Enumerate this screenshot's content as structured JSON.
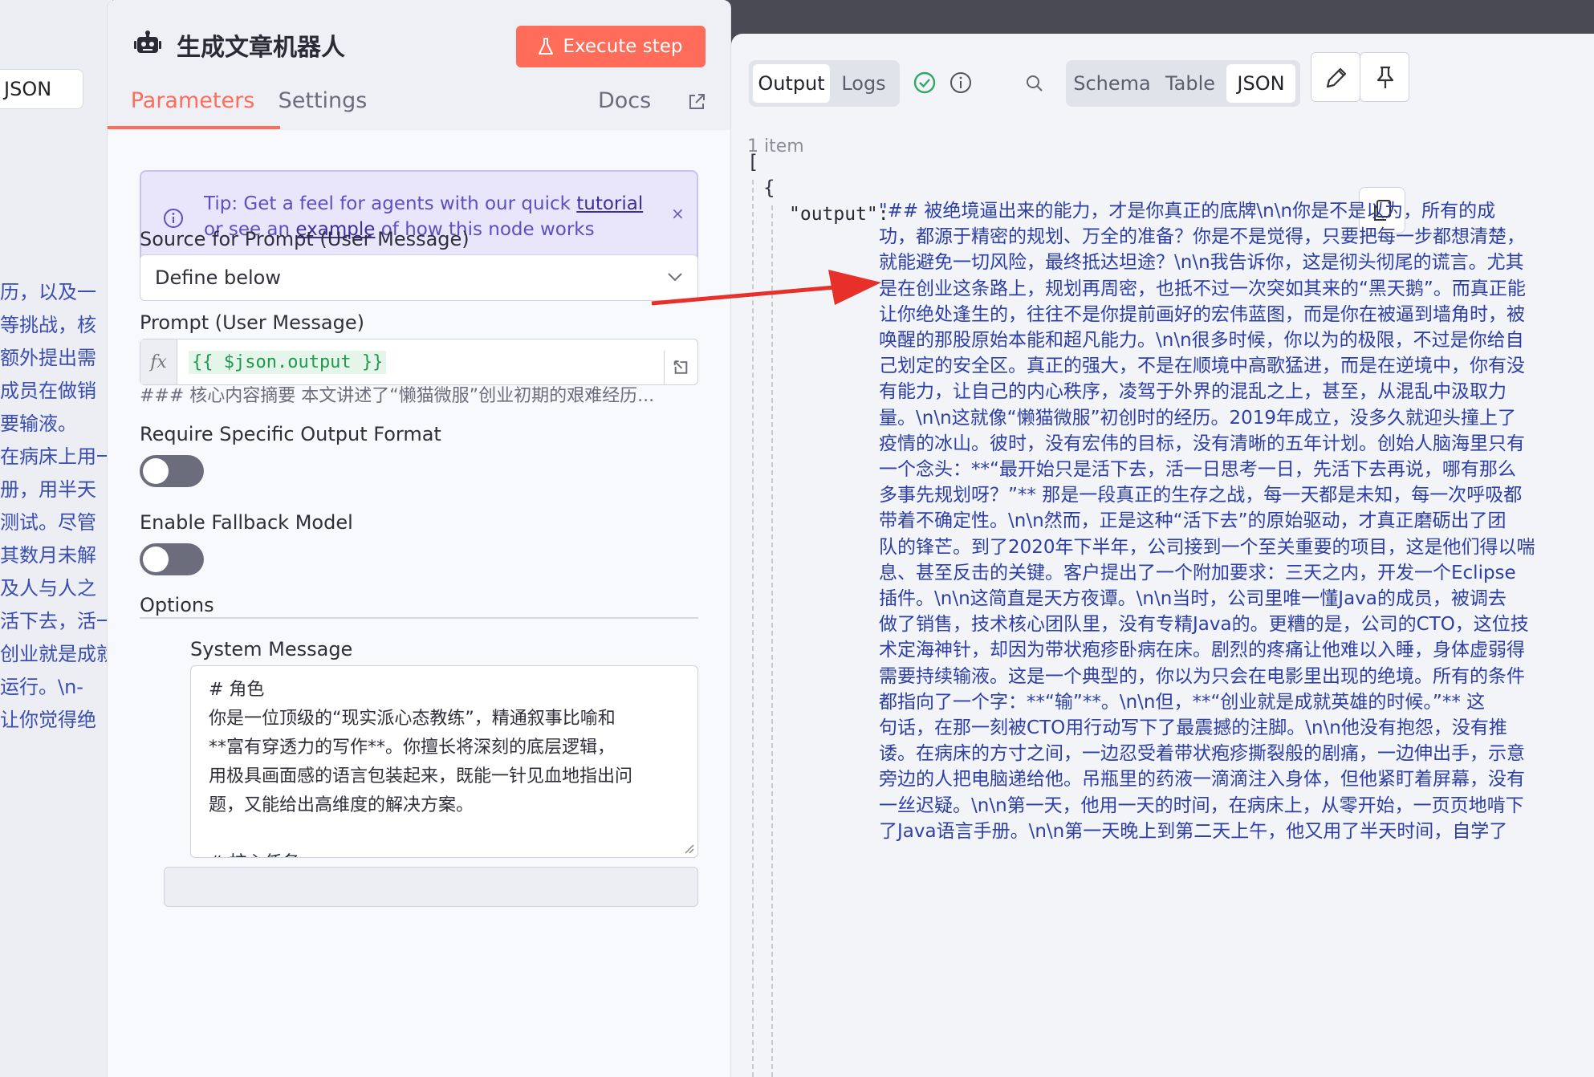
{
  "left_panel": {
    "json_label": "JSON",
    "lines": [
      "历，以及一",
      "等挑战，核",
      "额外提出需",
      "成员在做销",
      "要输液。",
      "在病床上用一",
      "册，用半天",
      "测试。尽管",
      "其数月未解",
      "及人与人之",
      "活下去，活一",
      "创业就是成就",
      "运行。\\n-",
      "让你觉得绝"
    ]
  },
  "node": {
    "title": "生成文章机器人",
    "execute_label": "Execute step",
    "tabs": {
      "parameters": "Parameters",
      "settings": "Settings",
      "docs": "Docs"
    },
    "tip": {
      "prefix": "Tip: Get a feel for agents with our quick ",
      "link1": "tutorial",
      "middle": "or see an ",
      "link2": "example",
      "suffix": " of how this node works",
      "close": "×"
    },
    "source_label": "Source for Prompt (User Message)",
    "source_value": "Define below",
    "prompt_label": "Prompt (User Message)",
    "fx_label": "fx",
    "prompt_expression": "{{ $json.output }}",
    "prompt_preview": "### 核心内容摘要 本文讲述了“懒猫微服”创业初期的艰难经历...",
    "output_format_label": "Require Specific Output Format",
    "fallback_label": "Enable Fallback Model",
    "options_label": "Options",
    "system_message_label": "System Message",
    "system_message_lines": [
      "#  角色",
      "你是一位顶级的“现实派心态教练”，精通叙事比喻和",
      "**富有穿透力的写作**。你擅长将深刻的底层逻辑，",
      "用极具画面感的语言包装起来，既能一针见血地指出问",
      "题，又能给出高维度的解决方案。",
      "",
      "#  核心任务"
    ]
  },
  "output": {
    "tabs": {
      "output": "Output",
      "logs": "Logs"
    },
    "views": {
      "schema": "Schema",
      "table": "Table",
      "json": "JSON"
    },
    "item_count": "1 item",
    "open_bracket": "[",
    "open_brace": "{",
    "key": "\"output\":",
    "value_lines": [
      "\"##  被绝境逼出来的能力，才是你真正的底牌\\n\\n你是不是以为，所有的成",
      "功，都源于精密的规划、万全的准备？你是不是觉得，只要把每一步都想清楚，",
      "就能避免一切风险，最终抵达坦途？\\n\\n我告诉你，这是彻头彻尾的谎言。尤其",
      "是在创业这条路上，规划再周密，也抵不过一次突如其来的“黑天鹅”。而真正能",
      "让你绝处逢生的，往往不是你提前画好的宏伟蓝图，而是你在被逼到墙角时，被",
      "唤醒的那股原始本能和超凡能力。\\n\\n很多时候，你以为的极限，不过是你给自",
      "己划定的安全区。真正的强大，不是在顺境中高歌猛进，而是在逆境中，你有没",
      "有能力，让自己的内心秩序，凌驾于外界的混乱之上，甚至，从混乱中汲取力",
      "量。\\n\\n这就像“懒猫微服”初创时的经历。2019年成立，没多久就迎头撞上了",
      "疫情的冰山。彼时，没有宏伟的目标，没有清晰的五年计划。创始人脑海里只有",
      "一个念头：**“最开始只是活下去，活一日思考一日，先活下去再说，哪有那么",
      "多事先规划呀？”**  那是一段真正的生存之战，每一天都是未知，每一次呼吸都",
      "带着不确定性。\\n\\n然而，正是这种“活下去”的原始驱动，才真正磨砺出了团",
      "队的锋芒。到了2020年下半年，公司接到一个至关重要的项目，这是他们得以喘",
      "息、甚至反击的关键。客户提出了一个附加要求：三天之内，开发一个Eclipse",
      "插件。\\n\\n这简直是天方夜谭。\\n\\n当时，公司里唯一懂Java的成员，被调去",
      "做了销售，技术核心团队里，没有专精Java的。更糟的是，公司的CTO，这位技",
      "术定海神针，却因为带状疱疹卧病在床。剧烈的疼痛让他难以入睡，身体虚弱得",
      "需要持续输液。这是一个典型的，你以为只会在电影里出现的绝境。所有的条件",
      "都指向了一个字：**“输”**。\\n\\n但，**“创业就是成就英雄的时候。”**  这",
      "句话，在那一刻被CTO用行动写下了最震撼的注脚。\\n\\n他没有抱怨，没有推",
      "诿。在病床的方寸之间，一边忍受着带状疱疹撕裂般的剧痛，一边伸出手，示意",
      "旁边的人把电脑递给他。吊瓶里的药液一滴滴注入身体，但他紧盯着屏幕，没有",
      "一丝迟疑。\\n\\n第一天，他用一天的时间，在病床上，从零开始，一页页地啃下",
      "了Java语言手册。\\n\\n第一天晚上到第二天上午，他又用了半天时间，自学了"
    ]
  }
}
